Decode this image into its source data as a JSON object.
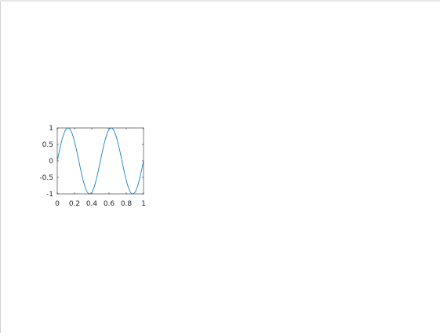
{
  "chart_data": {
    "type": "line",
    "title": "",
    "xlabel": "",
    "ylabel": "",
    "xlim": [
      0,
      1
    ],
    "ylim": [
      -1,
      1
    ],
    "grid": false,
    "x_ticks": [
      "0",
      "0.2",
      "0.4",
      "0.6",
      "0.8",
      "1"
    ],
    "y_ticks": [
      "1",
      "0.5",
      "0",
      "-0.5",
      "-1"
    ],
    "series": [
      {
        "function": "sin(4*pi*x)",
        "x_range": [
          0,
          1
        ],
        "color": "#0072BD"
      }
    ]
  },
  "colors": {
    "axes": "#262626",
    "line": "#0072BD",
    "background": "#ffffff"
  }
}
